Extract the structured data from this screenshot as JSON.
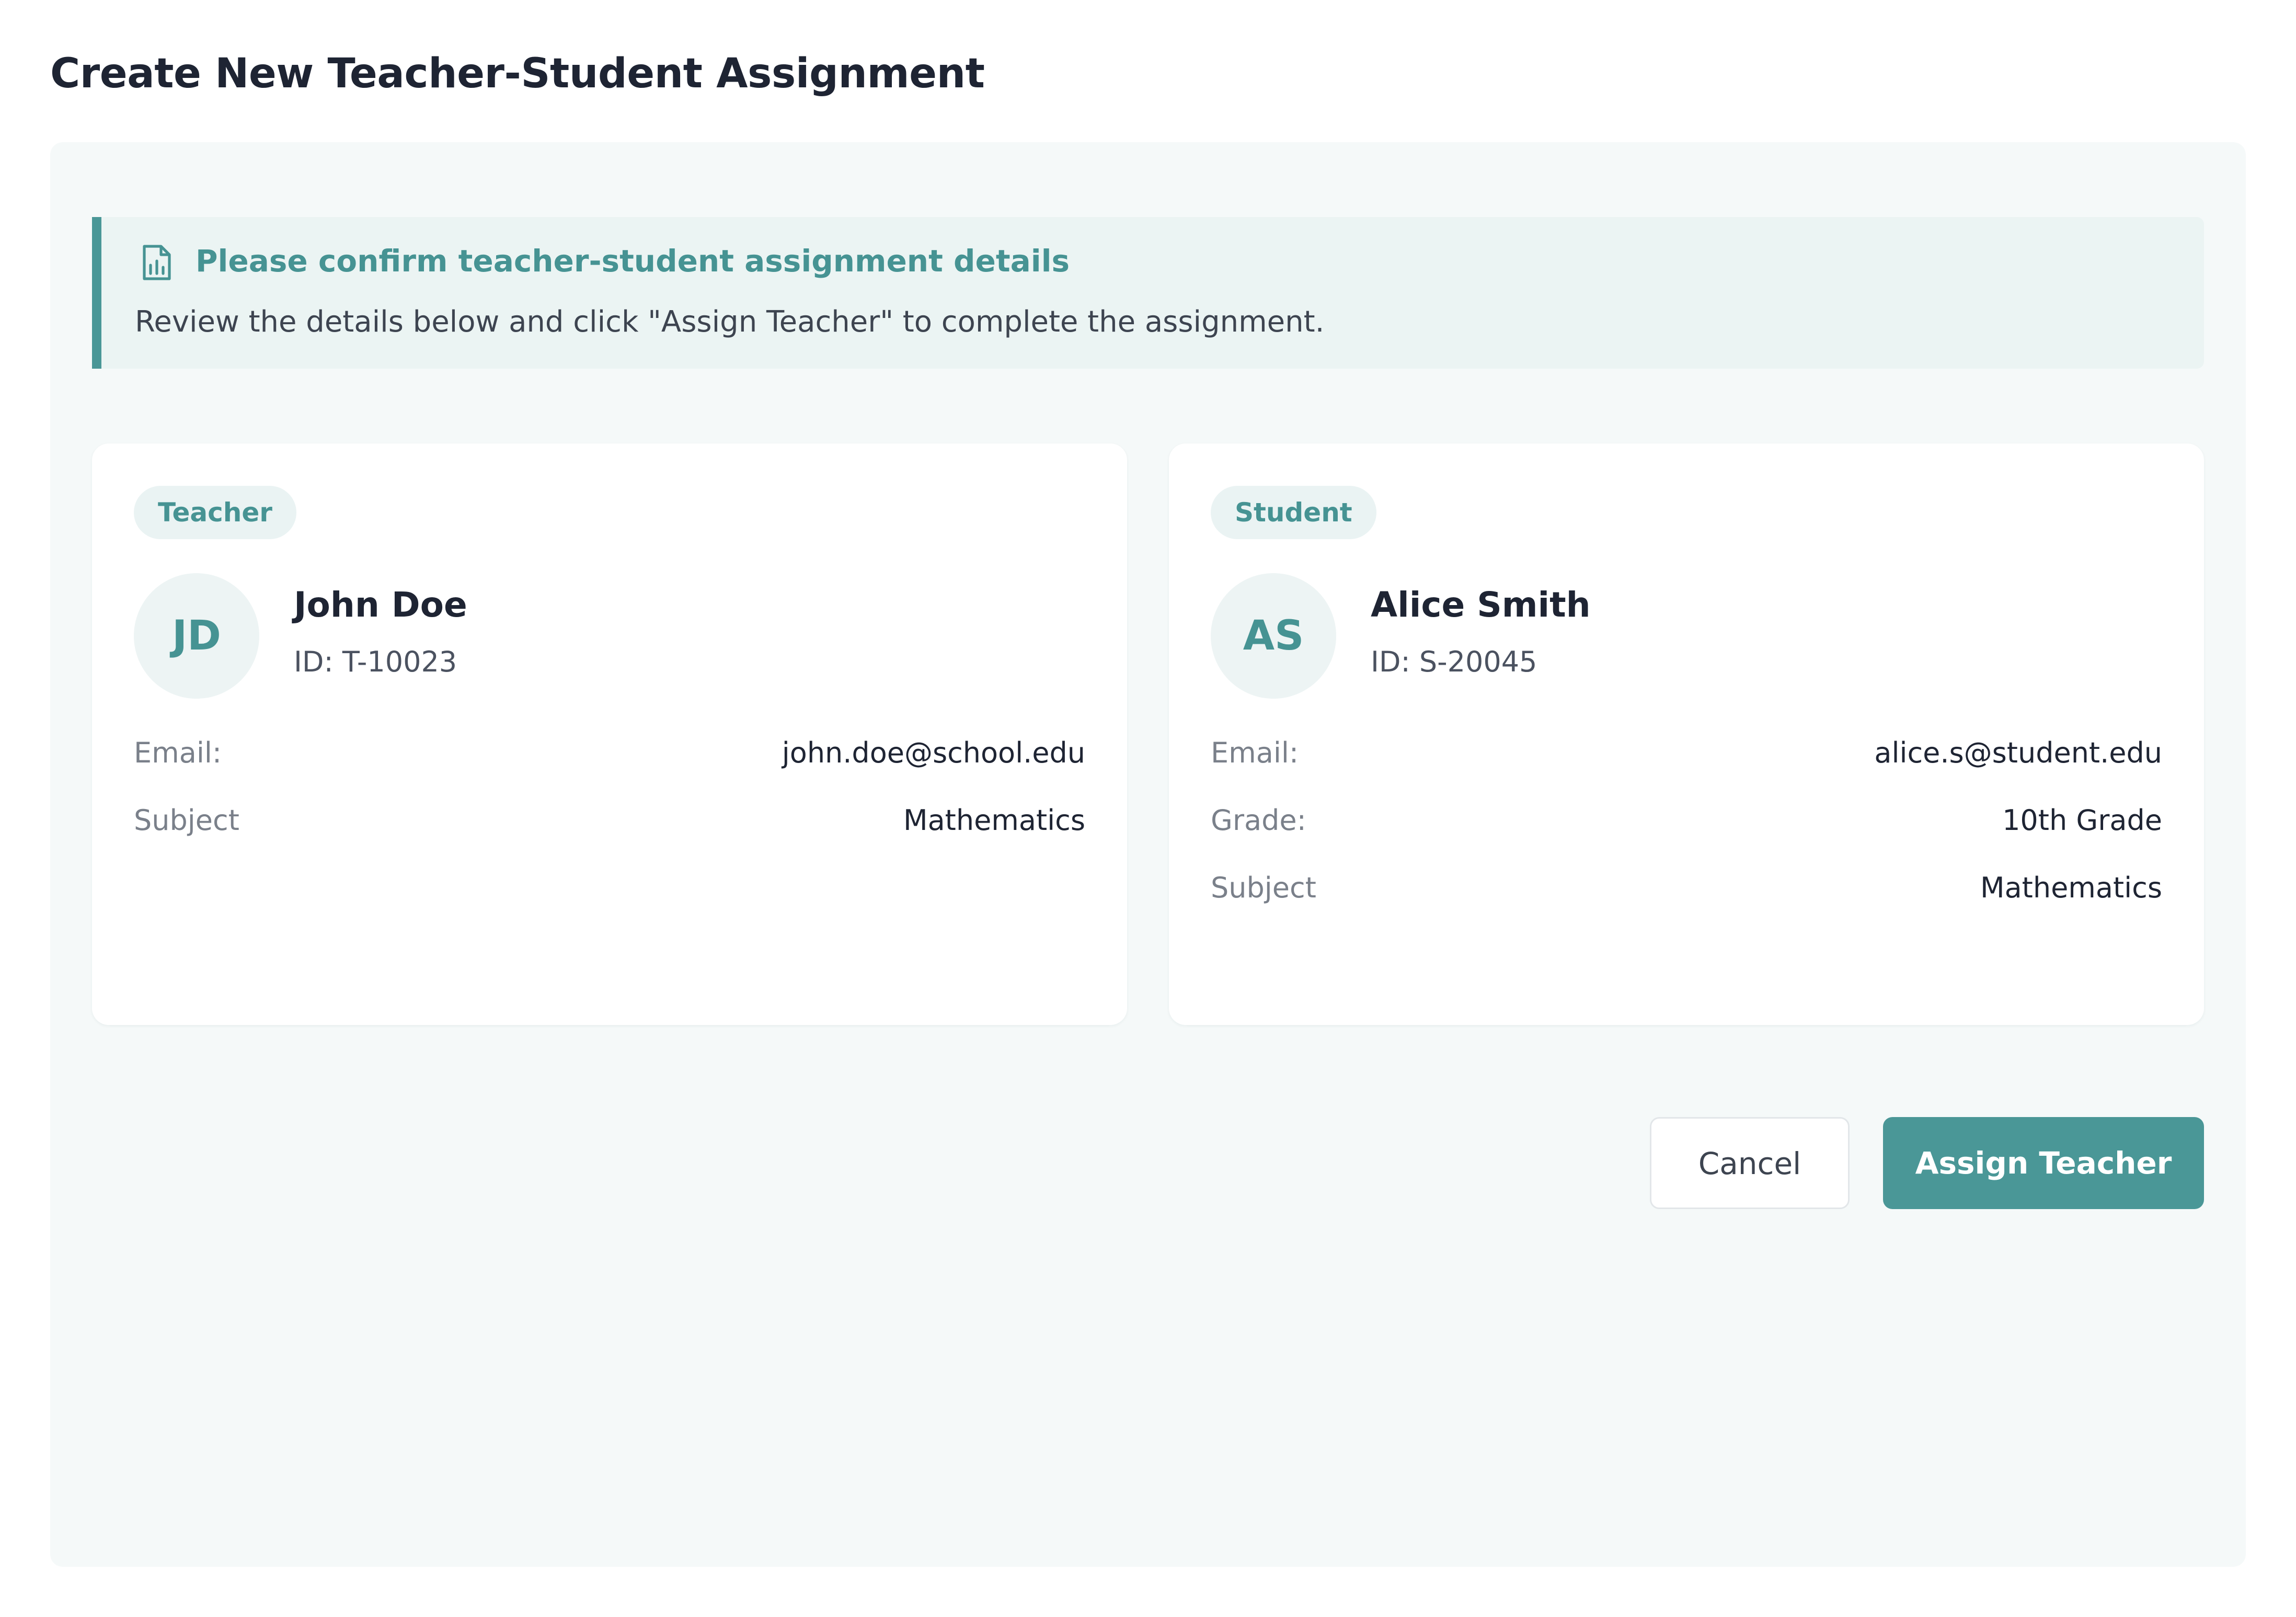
{
  "page": {
    "title": "Create New Teacher-Student Assignment"
  },
  "notice": {
    "icon": "report-document-icon",
    "title": "Please confirm teacher-student assignment details",
    "text": "Review the details below and click \"Assign Teacher\" to complete the assignment."
  },
  "teacher": {
    "badge": "Teacher",
    "initials": "JD",
    "name": "John Doe",
    "id": "ID: T-10023",
    "fields": [
      {
        "label": "Email:",
        "value": "john.doe@school.edu"
      },
      {
        "label": "Subject",
        "value": "Mathematics"
      }
    ]
  },
  "student": {
    "badge": "Student",
    "initials": "AS",
    "name": "Alice Smith",
    "id": "ID: S-20045",
    "fields": [
      {
        "label": "Email:",
        "value": "alice.s@student.edu"
      },
      {
        "label": "Grade:",
        "value": "10th Grade"
      },
      {
        "label": "Subject",
        "value": "Mathematics"
      }
    ]
  },
  "actions": {
    "cancel_label": "Cancel",
    "assign_label": "Assign Teacher"
  },
  "colors": {
    "accent": "#4a9797",
    "panel_background": "#f5f9f9",
    "notice_background": "#ebf4f3"
  }
}
